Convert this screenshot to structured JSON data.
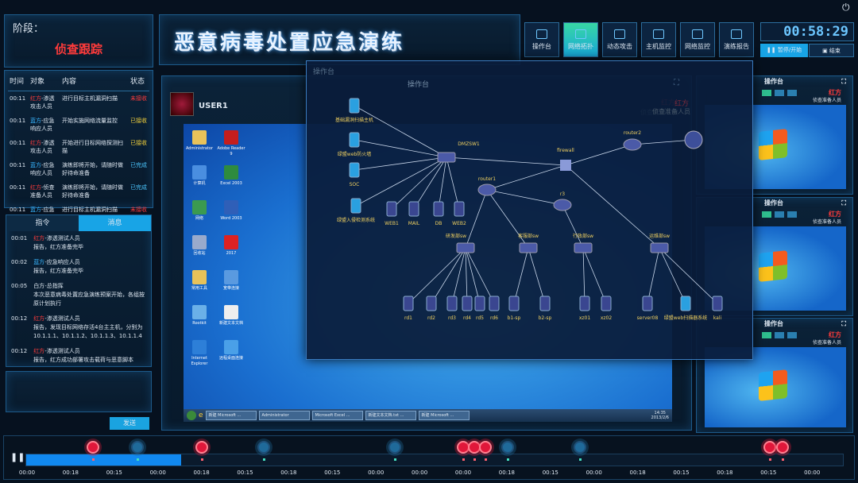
{
  "header": {
    "title": "恶意病毒处置应急演练",
    "stage_label": "阶段：",
    "stage_value": "侦查跟踪"
  },
  "nav": [
    {
      "label": "操作台",
      "icon": "monitor-icon"
    },
    {
      "label": "网络拓扑",
      "icon": "topology-icon",
      "active": true
    },
    {
      "label": "动态攻击",
      "icon": "attack-icon"
    },
    {
      "label": "主机监控",
      "icon": "host-monitor-icon"
    },
    {
      "label": "网络监控",
      "icon": "network-monitor-icon"
    },
    {
      "label": "演练报告",
      "icon": "report-icon"
    }
  ],
  "timer": {
    "value": "00:58:29",
    "pause_label": "暂停/开始",
    "end_label": "结束"
  },
  "events": {
    "columns": [
      "时间",
      "对象",
      "内容",
      "状态"
    ],
    "rows": [
      {
        "time": "00:11",
        "side": "红方",
        "role": "-渗透攻击人员",
        "content": "进行目标主机漏洞扫描",
        "status": "未接收",
        "side_color": "red",
        "status_color": "red"
      },
      {
        "time": "00:11",
        "side": "蓝方",
        "role": "-应急响应人员",
        "content": "开始实施网络流量监控",
        "status": "已接收",
        "side_color": "blue",
        "status_color": "yellow"
      },
      {
        "time": "00:11",
        "side": "红方",
        "role": "-渗透攻击人员",
        "content": "开始进行目标网络探测扫描",
        "status": "已接收",
        "side_color": "red",
        "status_color": "yellow"
      },
      {
        "time": "00:11",
        "side": "蓝方",
        "role": "-应急响应人员",
        "content": "演练即将开始，请随时做好待命准备",
        "status": "已完成",
        "side_color": "blue",
        "status_color": "done"
      },
      {
        "time": "00:11",
        "side": "红方",
        "role": "-侦查准备人员",
        "content": "演练即将开始，请随时做好待命准备",
        "status": "已完成",
        "side_color": "red",
        "status_color": "done"
      },
      {
        "time": "00:11",
        "side": "蓝方",
        "role": "-应急所有人员",
        "content": "进行目标主机漏洞扫描",
        "status": "未接收",
        "side_color": "blue",
        "status_color": "red"
      }
    ]
  },
  "msg_tabs": {
    "command": "指令",
    "message": "消息"
  },
  "messages": [
    {
      "time": "00:01",
      "side": "红方",
      "role": "-渗透测试人员",
      "text": "报告，红方准备完毕",
      "side_color": "red"
    },
    {
      "time": "00:02",
      "side": "蓝方",
      "role": "-应急响应人员",
      "text": "报告，红方准备完毕",
      "side_color": "blue"
    },
    {
      "time": "00:05",
      "side": "白方",
      "role": "-总指挥",
      "text": "本次恶意病毒处置应急演练预案开始，各组按原计划执行",
      "side_color": "white"
    },
    {
      "time": "00:12",
      "side": "红方",
      "role": "-渗透测试人员",
      "text": "报告，发现目标网络存活4台主主机，分别为10.1.1.1、10.1.1.2、10.1.1.3、10.1.1.4",
      "side_color": "red"
    },
    {
      "time": "00:12",
      "side": "红方",
      "role": "-渗透测试人员",
      "text": "报告，红方成功部署攻击载荷与恶意脚本",
      "side_color": "red"
    }
  ],
  "send_label": "发送",
  "user_panel": {
    "name": "USER1",
    "console": "操作台",
    "side": "红方",
    "role": "侦查准备人员"
  },
  "desktop": {
    "icons": [
      "Administrator",
      "Adobe Reader 9",
      "计算机",
      "Excel 2003",
      "网络",
      "Word 2003",
      "回收站",
      "2017",
      "常用工具",
      "宽带连接",
      "Rootkit",
      "新建文本文档",
      "Internet Explorer",
      "远程桌面连接"
    ],
    "taskbar": [
      "新建 Microsoft ...",
      "Administrator",
      "Microsoft Excel ...",
      "新建文本文档.txt ...",
      "新建 Microsoft ..."
    ],
    "clock_time": "14:35",
    "clock_date": "2013/2/6"
  },
  "topology": {
    "title": "操作台",
    "side": "红方",
    "role": "侦查准备人员",
    "nodes": [
      "基础漏洞扫描主机",
      "绿盟web防火墙",
      "SOC",
      "绿盟入侵检测系统",
      "WEB1",
      "MAIL",
      "DB",
      "WEB2",
      "DMZSW1",
      "router1",
      "firewall",
      "router2",
      "",
      "r3",
      "研发部sw",
      "客服部sw",
      "行政部sw",
      "运维部sw",
      "rd1",
      "rd2",
      "rd3",
      "rd4",
      "rd5",
      "rd6",
      "b1-sp",
      "b2-sp",
      "xz01",
      "xz02",
      "server08",
      "绿盟web扫描器系统",
      "kali"
    ],
    "links": [
      [
        "基础漏洞扫描主机",
        "DMZSW1"
      ],
      [
        "绿盟web防火墙",
        "DMZSW1"
      ],
      [
        "SOC",
        "DMZSW1"
      ],
      [
        "绿盟入侵检测系统",
        "DMZSW1"
      ],
      [
        "WEB1",
        "DMZSW1"
      ],
      [
        "MAIL",
        "DMZSW1"
      ],
      [
        "DB",
        "DMZSW1"
      ],
      [
        "WEB2",
        "DMZSW1"
      ],
      [
        "DMZSW1",
        "firewall"
      ],
      [
        "router1",
        "firewall"
      ],
      [
        "firewall",
        "router2"
      ],
      [
        "router2",
        "internet"
      ],
      [
        "firewall",
        "运维部sw"
      ],
      [
        "router1",
        "r3"
      ],
      [
        "router1",
        "研发部sw"
      ],
      [
        "router1",
        "客服部sw"
      ],
      [
        "r3",
        "行政部sw"
      ],
      [
        "研发部sw",
        "rd1"
      ],
      [
        "研发部sw",
        "rd2"
      ],
      [
        "研发部sw",
        "rd3"
      ],
      [
        "研发部sw",
        "rd4"
      ],
      [
        "研发部sw",
        "rd5"
      ],
      [
        "研发部sw",
        "rd6"
      ],
      [
        "客服部sw",
        "b1-sp"
      ],
      [
        "客服部sw",
        "b2-sp"
      ],
      [
        "行政部sw",
        "xz01"
      ],
      [
        "行政部sw",
        "xz02"
      ],
      [
        "运维部sw",
        "server08"
      ],
      [
        "运维部sw",
        "绿盟web扫描器系统"
      ],
      [
        "运维部sw",
        "kali"
      ]
    ]
  },
  "right_panels": [
    {
      "title": "操作台",
      "side": "红方",
      "role": "侦查准备人员"
    },
    {
      "title": "操作台",
      "side": "红方",
      "role": "侦查准备人员"
    },
    {
      "title": "操作台",
      "side": "红方",
      "role": "侦查准备人员"
    }
  ],
  "timeline": {
    "progress": 0.19,
    "ticks": [
      "00:00",
      "00:18",
      "00:15",
      "00:00",
      "00:18",
      "00:15",
      "00:18",
      "00:15",
      "00:00",
      "00:00",
      "00:00",
      "00:18",
      "00:15",
      "00:00",
      "00:18",
      "00:15",
      "00:18",
      "00:15",
      "00:00"
    ],
    "markers": [
      {
        "type": "red",
        "pos": 0.083
      },
      {
        "type": "blue",
        "pos": 0.137
      },
      {
        "type": "red",
        "pos": 0.216
      },
      {
        "type": "blue",
        "pos": 0.291
      },
      {
        "type": "blue",
        "pos": 0.451
      },
      {
        "type": "red",
        "pos": 0.535
      },
      {
        "type": "red",
        "pos": 0.549
      },
      {
        "type": "red",
        "pos": 0.562
      },
      {
        "type": "blue",
        "pos": 0.589
      },
      {
        "type": "blue",
        "pos": 0.678
      },
      {
        "type": "red",
        "pos": 0.91
      },
      {
        "type": "red",
        "pos": 0.925
      }
    ]
  },
  "colors": {
    "red": "#ff3b3b",
    "blue": "#38b6ff",
    "accent": "#18a4e6",
    "active_nav": "#38d7a4"
  }
}
